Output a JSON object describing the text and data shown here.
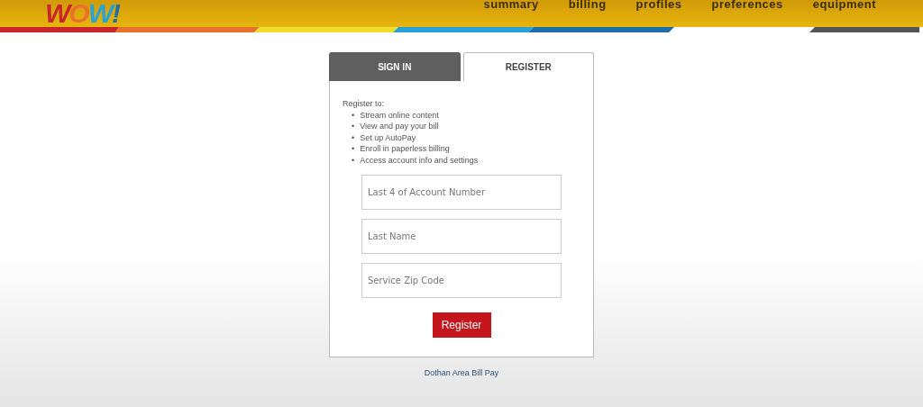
{
  "header": {
    "logo": "WOW!",
    "nav": [
      {
        "label": "summary"
      },
      {
        "label": "billing"
      },
      {
        "label": "profiles"
      },
      {
        "label": "preferences"
      },
      {
        "label": "equipment"
      }
    ]
  },
  "tabs": [
    {
      "label": "SIGN IN",
      "selected": false
    },
    {
      "label": "REGISTER",
      "selected": true
    }
  ],
  "register": {
    "intro": "Register to:",
    "benefits": [
      {
        "bullet": "•",
        "text": "Stream online content"
      },
      {
        "bullet": "•",
        "text": "View and pay your bill"
      },
      {
        "bullet": "•",
        "text": "Set up AutoPay"
      },
      {
        "bullet": "•",
        "text": "Enroll in paperless billing"
      },
      {
        "bullet": "•",
        "text": "Access account info and settings"
      }
    ],
    "fields": [
      {
        "placeholder": "Last 4 of Account Number"
      },
      {
        "placeholder": "Last Name"
      },
      {
        "placeholder": "Service Zip Code"
      }
    ],
    "button": "Register"
  },
  "link": "Dothan Area Bill Pay"
}
